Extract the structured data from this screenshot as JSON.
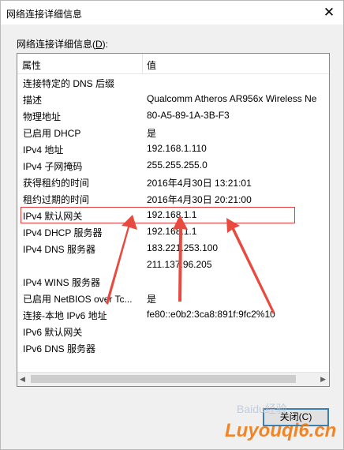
{
  "window": {
    "title": "网络连接详细信息",
    "close_glyph": "✕"
  },
  "list": {
    "label_prefix": "网络连接详细信息(",
    "label_key": "D",
    "label_suffix": "):",
    "headers": {
      "property": "属性",
      "value": "值"
    },
    "rows": [
      {
        "property": "连接特定的 DNS 后缀",
        "value": ""
      },
      {
        "property": "描述",
        "value": "Qualcomm Atheros AR956x Wireless Ne"
      },
      {
        "property": "物理地址",
        "value": "80-A5-89-1A-3B-F3"
      },
      {
        "property": "已启用 DHCP",
        "value": "是"
      },
      {
        "property": "IPv4 地址",
        "value": "192.168.1.110"
      },
      {
        "property": "IPv4 子网掩码",
        "value": "255.255.255.0"
      },
      {
        "property": "获得租约的时间",
        "value": "2016年4月30日 13:21:01"
      },
      {
        "property": "租约过期的时间",
        "value": "2016年4月30日 20:21:00"
      },
      {
        "property": "IPv4 默认网关",
        "value": "192.168.1.1"
      },
      {
        "property": "IPv4 DHCP 服务器",
        "value": "192.168.1.1"
      },
      {
        "property": "IPv4 DNS 服务器",
        "value": "183.221.253.100"
      },
      {
        "property": "",
        "value": "211.137.96.205"
      },
      {
        "property": "IPv4 WINS 服务器",
        "value": ""
      },
      {
        "property": "已启用 NetBIOS over Tc...",
        "value": "是"
      },
      {
        "property": "连接-本地 IPv6 地址",
        "value": "fe80::e0b2:3ca8:891f:9fc2%10"
      },
      {
        "property": "IPv6 默认网关",
        "value": ""
      },
      {
        "property": "IPv6 DNS 服务器",
        "value": ""
      }
    ]
  },
  "scrollbar": {
    "left_icon": "scroll-left-icon",
    "right_icon": "scroll-right-icon"
  },
  "buttons": {
    "close_label": "关闭(C)"
  },
  "annotation": {
    "highlight_color": "#e33d3d"
  },
  "watermark": {
    "text": "Luyouqi6.cn",
    "baidu": "Baidu经验"
  }
}
